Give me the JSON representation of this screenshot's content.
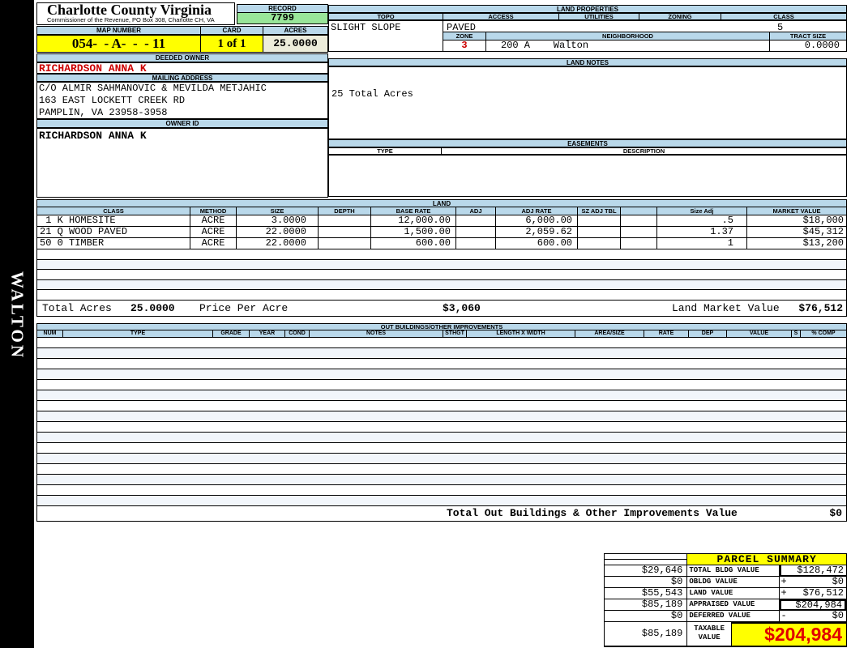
{
  "colors": {
    "header_blue": "#B9D8EA",
    "record_green": "#99E699",
    "highlight_yellow": "#FFFF00",
    "acres_cream": "#EDEDDB",
    "alert_red": "#CC0000"
  },
  "sidebar": {
    "district": "WALTON"
  },
  "header": {
    "county": "Charlotte County Virginia",
    "subtitle": "Commissioner of the Revenue, PO Box 308, Charlotte CH, VA",
    "record_label": "RECORD",
    "record_value": "7799",
    "map_number_label": "MAP NUMBER",
    "map_number": "054-  - A-  -  - 11",
    "card_label": "CARD",
    "card": "1 of 1",
    "acres_label": "ACRES",
    "acres": "25.0000",
    "deeded_owner_label": "DEEDED OWNER",
    "deeded_owner": "RICHARDSON ANNA K",
    "mailing_address_label": "MAILING ADDRESS",
    "address_line1": "C/O ALMIR SAHMANOVIC & MEVILDA METJAHIC",
    "address_line2": "163 EAST LOCKETT CREEK RD",
    "address_line3": "PAMPLIN, VA 23958-3958",
    "owner_id_label": "OWNER ID",
    "owner_id": "RICHARDSON ANNA K"
  },
  "land_properties": {
    "title": "LAND PROPERTIES",
    "headers": [
      "TOPO",
      "ACCESS",
      "UTILITIES",
      "ZONING",
      "CLASS"
    ],
    "topo": "SLIGHT SLOPE",
    "access": "PAVED",
    "utilities": "",
    "zoning": "",
    "class": "5",
    "zone_label": "ZONE",
    "zone": "3",
    "neighborhood_label": "NEIGHBORHOOD",
    "neighborhood": "200 A    Walton",
    "tract_size_label": "TRACT SIZE",
    "tract_size": "0.0000"
  },
  "land_notes": {
    "title": "LAND NOTES",
    "note": "25 Total Acres"
  },
  "easements": {
    "title": "EASEMENTS",
    "type_label": "TYPE",
    "description_label": "DESCRIPTION"
  },
  "land": {
    "title": "LAND",
    "headers": [
      "CLASS",
      "METHOD",
      "SIZE",
      "DEPTH",
      "BASE RATE",
      "ADJ",
      "ADJ RATE",
      "SZ ADJ TBL",
      "",
      "Size Adj",
      "MARKET VALUE"
    ],
    "rows": [
      {
        "class": " 1 K HOMESITE",
        "method": "ACRE",
        "size": "3.0000",
        "depth": "",
        "base_rate": "12,000.00",
        "adj": "",
        "adj_rate": "6,000.00",
        "sz_adj_tbl": "",
        "blank": "",
        "size_adj": ".5",
        "market_value": "$18,000"
      },
      {
        "class": "21 Q WOOD PAVED",
        "method": "ACRE",
        "size": "22.0000",
        "depth": "",
        "base_rate": "1,500.00",
        "adj": "",
        "adj_rate": "2,059.62",
        "sz_adj_tbl": "",
        "blank": "",
        "size_adj": "1.37",
        "market_value": "$45,312"
      },
      {
        "class": "50 0 TIMBER",
        "method": "ACRE",
        "size": "22.0000",
        "depth": "",
        "base_rate": "600.00",
        "adj": "",
        "adj_rate": "600.00",
        "sz_adj_tbl": "",
        "blank": "",
        "size_adj": "1",
        "market_value": "$13,200"
      }
    ],
    "totals": {
      "total_acres_label": "Total Acres",
      "total_acres": "25.0000",
      "price_per_acre_label": "Price Per Acre",
      "price_per_acre": "$3,060",
      "land_market_value_label": "Land Market Value",
      "land_market_value": "$76,512"
    }
  },
  "out_buildings": {
    "title": "OUT BUILDINGS/OTHER IMPROVEMENTS",
    "headers": [
      "NUM",
      "TYPE",
      "GRADE",
      "YEAR",
      "COND",
      "NOTES",
      "STHGT",
      "LENGTH X WIDTH",
      "AREA/SIZE",
      "RATE",
      "DEP",
      "VALUE",
      "S",
      "% COMP"
    ],
    "total_label": "Total Out Buildings & Other Improvements Value",
    "total_value": "$0"
  },
  "parcel_summary": {
    "title": "PARCEL SUMMARY",
    "rows": [
      {
        "left": "$29,646",
        "label": "TOTAL BLDG VALUE",
        "sign": "",
        "value": "$128,472"
      },
      {
        "left": "$0",
        "label": "OBLDG VALUE",
        "sign": "+",
        "value": "$0"
      },
      {
        "left": "$55,543",
        "label": "LAND VALUE",
        "sign": "+",
        "value": "$76,512"
      },
      {
        "left": "$85,189",
        "label": "APPRAISED VALUE",
        "sign": "",
        "value": "$204,984"
      },
      {
        "left": "$0",
        "label": "DEFERRED VALUE",
        "sign": "-",
        "value": "$0"
      }
    ],
    "taxable": {
      "left": "$85,189",
      "label_line1": "TAXABLE",
      "label_line2": "VALUE",
      "value": "$204,984"
    }
  }
}
